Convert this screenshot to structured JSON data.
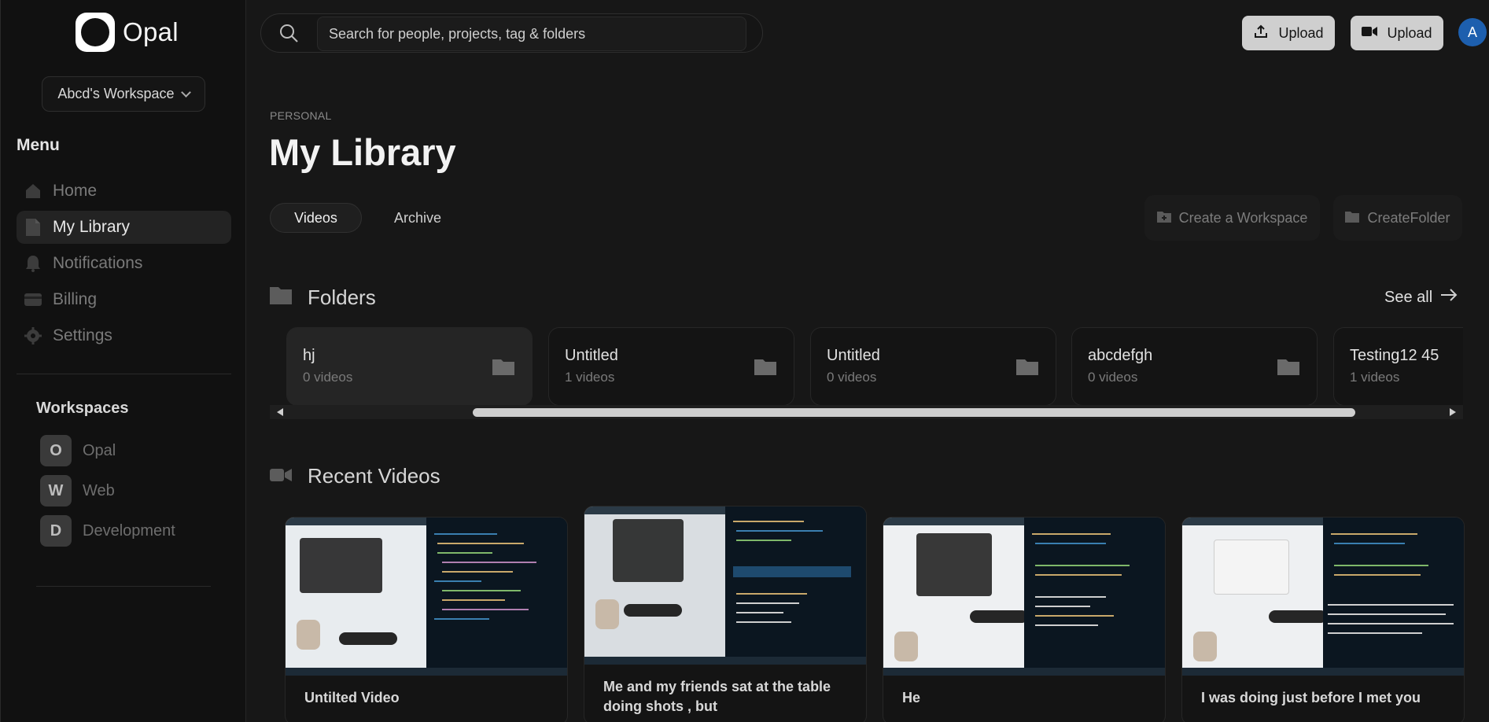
{
  "app": {
    "name": "Opal"
  },
  "workspace_selector": {
    "label": "Abcd's Workspace"
  },
  "sidebar": {
    "menu_title": "Menu",
    "items": [
      {
        "label": "Home",
        "icon": "home-icon",
        "active": false
      },
      {
        "label": "My Library",
        "icon": "document-icon",
        "active": true
      },
      {
        "label": "Notifications",
        "icon": "bell-icon",
        "active": false
      },
      {
        "label": "Billing",
        "icon": "credit-card-icon",
        "active": false
      },
      {
        "label": "Settings",
        "icon": "gear-icon",
        "active": false
      }
    ],
    "workspaces_title": "Workspaces",
    "workspaces": [
      {
        "initial": "O",
        "name": "Opal"
      },
      {
        "initial": "W",
        "name": "Web"
      },
      {
        "initial": "D",
        "name": "Development"
      }
    ]
  },
  "header": {
    "search_placeholder": "Search for people, projects, tag & folders",
    "upload_label": "Upload",
    "record_upload_label": "Upload",
    "avatar_initial": "A"
  },
  "main": {
    "eyebrow": "PERSONAL",
    "title": "My Library",
    "tabs": [
      {
        "label": "Videos",
        "active": true
      },
      {
        "label": "Archive",
        "active": false
      }
    ],
    "create_workspace_label": "Create a Workspace",
    "create_folder_label": "CreateFolder",
    "folders_title": "Folders",
    "see_all_label": "See all",
    "folders": [
      {
        "name": "hj",
        "count": "0 videos"
      },
      {
        "name": "Untitled",
        "count": "1 videos"
      },
      {
        "name": "Untitled",
        "count": "0 videos"
      },
      {
        "name": "abcdefgh",
        "count": "0 videos"
      },
      {
        "name": "Testing12 45",
        "count": "1 videos"
      }
    ],
    "recent_title": "Recent Videos",
    "videos": [
      {
        "title": "Untilted Video"
      },
      {
        "title": "Me and my friends sat at the table doing shots , but"
      },
      {
        "title": "He"
      },
      {
        "title": "I was doing just before I met you"
      }
    ]
  },
  "colors": {
    "background": "#171717",
    "sidebar": "#111111",
    "avatar": "#1d5fae",
    "upload_button": "#cfcfcf"
  }
}
